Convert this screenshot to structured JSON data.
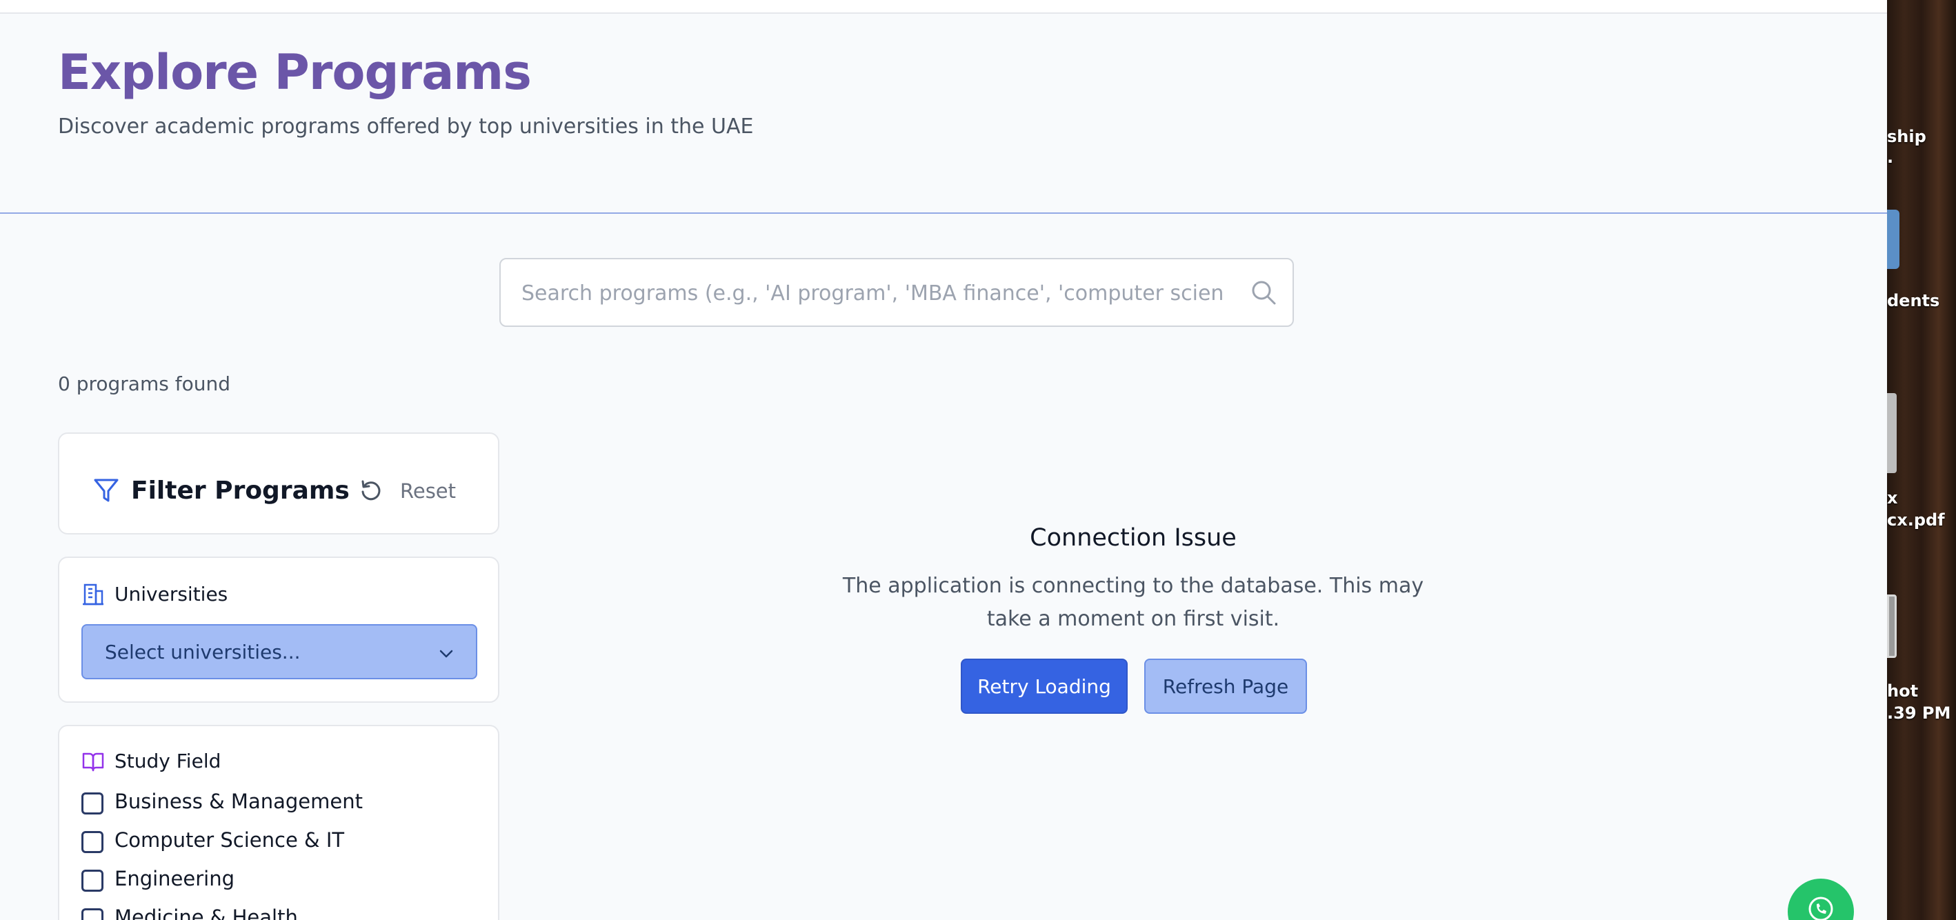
{
  "header": {
    "title": "Explore Programs",
    "subtitle": "Discover academic programs offered by top universities in the UAE"
  },
  "search": {
    "placeholder": "Search programs (e.g., 'AI program', 'MBA finance', 'computer science')",
    "value": "",
    "icon": "search-icon"
  },
  "results": {
    "count_text": "0 programs found"
  },
  "filters": {
    "title": "Filter Programs",
    "reset_label": "Reset",
    "universities": {
      "label": "Universities",
      "select_placeholder": "Select universities..."
    },
    "study_field": {
      "label": "Study Field",
      "options": [
        {
          "label": "Business & Management",
          "checked": false
        },
        {
          "label": "Computer Science & IT",
          "checked": false
        },
        {
          "label": "Engineering",
          "checked": false
        },
        {
          "label": "Medicine & Health",
          "checked": false
        }
      ]
    }
  },
  "status": {
    "title": "Connection Issue",
    "message": "The application is connecting to the database. This may take a moment on first visit.",
    "retry_label": "Retry Loading",
    "refresh_label": "Refresh Page"
  },
  "desktop": {
    "labels": [
      "ship",
      ".",
      "dents",
      "x",
      "cx.pdf",
      "hot",
      ".39 PM"
    ]
  },
  "colors": {
    "title": "#6b56a8",
    "primary": "#3563e2",
    "primary_light": "#a3bcf5",
    "whatsapp": "#25c46a",
    "background": "#f8fafc"
  }
}
